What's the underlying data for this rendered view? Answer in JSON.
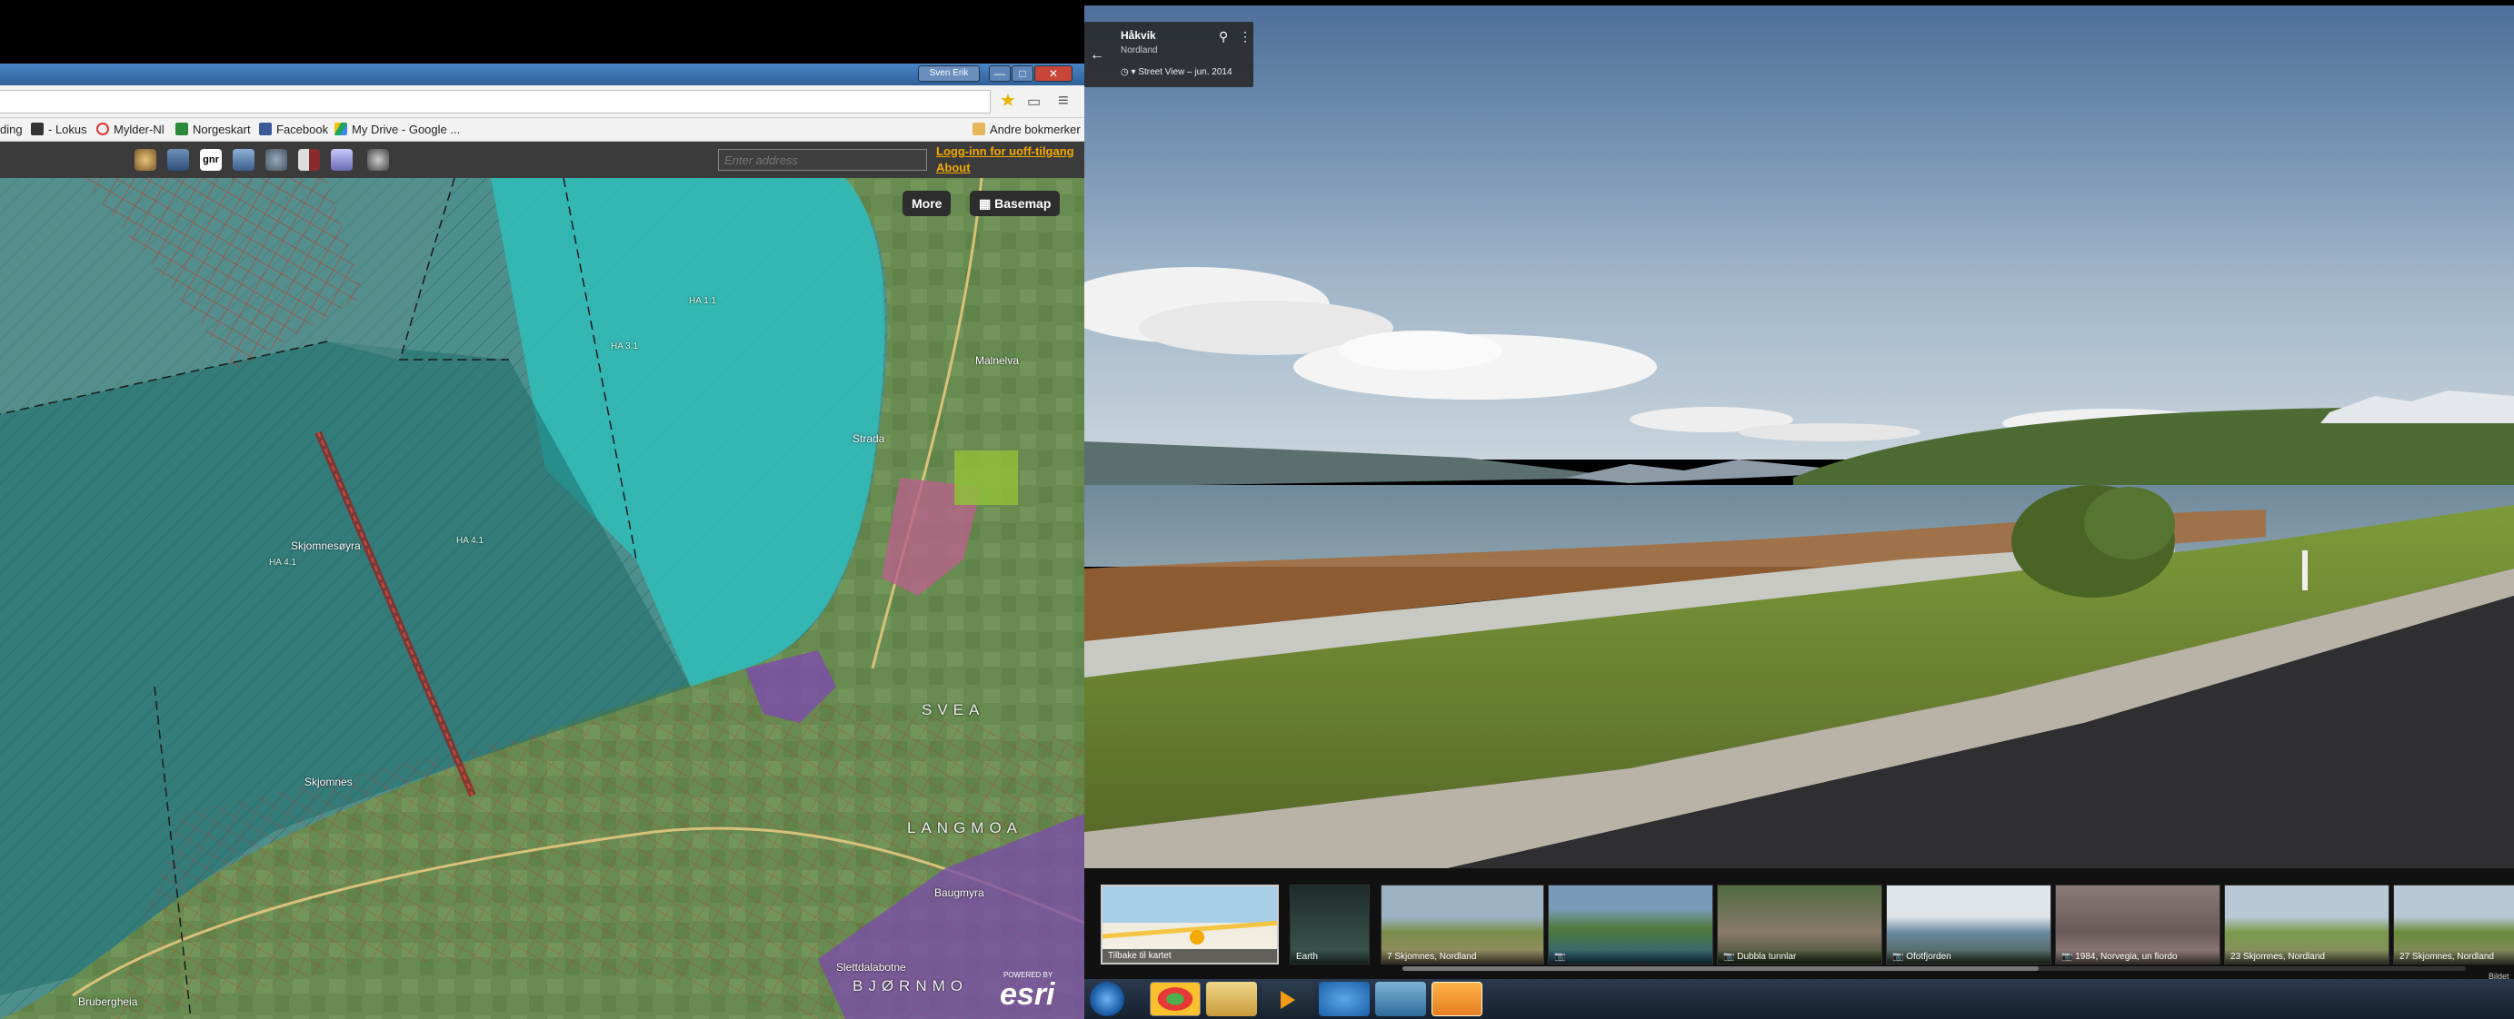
{
  "browser": {
    "window_controls": {
      "switch_user": "Sven Erik",
      "minimize": "—",
      "maximize": "□",
      "close": "✕"
    },
    "bookmarks": [
      {
        "label": "ding",
        "icon": "none"
      },
      {
        "label": "- Lokus",
        "icon": "lokus-icon"
      },
      {
        "label": "Mylder-Nl",
        "icon": "mylder-icon"
      },
      {
        "label": "Norgeskart",
        "icon": "norgeskart-icon"
      },
      {
        "label": "Facebook",
        "icon": "facebook-icon"
      },
      {
        "label": "My Drive - Google ...",
        "icon": "drive-icon"
      },
      {
        "label": "Andre bokmerker",
        "icon": "folder-icon"
      }
    ],
    "colors": {
      "titlebar": "#3a70b0",
      "toolbar": "#3b3b3b",
      "link": "#f2a900"
    }
  },
  "map_app": {
    "address_placeholder": "Enter address",
    "login_link": "Logg-inn for uoff-tilgang",
    "about_link": "About",
    "more_button": "More",
    "basemap_button": "Basemap",
    "tool_icons": [
      "compass-icon",
      "truck-icon",
      "gnr-icon",
      "layers-icon",
      "gears-icon",
      "book-icon",
      "cube-icon",
      "vehicle-icon"
    ],
    "gnr_label": "gnr",
    "labels": {
      "skjomnesoyra": "Skjomnesøyra",
      "skjomnes": "Skjomnes",
      "strada": "Strada",
      "malnelva": "Malnelva",
      "svea": "SVEA",
      "langmoa": "LANGMOA",
      "bjornmo": "BJØRNMO",
      "slettdalabotne": "Slettdalabotne",
      "baugmyra": "Baugmyra",
      "bruberget": "Brubergheia",
      "ha41a": "HA 4.1",
      "ha41b": "HA 4.1",
      "ha31": "HA 3.1",
      "ha11": "HA 1.1"
    },
    "esri_logo": "esri",
    "esri_powered": "POWERED BY"
  },
  "street_view": {
    "location_title": "Håkvik",
    "region": "Nordland",
    "date": "Street View – jun. 2014",
    "back_icon": "arrow-left-icon",
    "filmstrip": [
      {
        "caption": "Tilbake til kartet",
        "kind": "map"
      },
      {
        "caption": "Earth",
        "kind": "earth"
      },
      {
        "caption": "7 Skjomnes, Nordland",
        "kind": "photo"
      },
      {
        "caption": "",
        "kind": "photo"
      },
      {
        "caption": "Dubbla tunnlar",
        "kind": "photo"
      },
      {
        "caption": "Ofotfjorden",
        "kind": "photo"
      },
      {
        "caption": "1984, Norvegia, un fiordo",
        "kind": "photo"
      },
      {
        "caption": "23 Skjomnes, Nordland",
        "kind": "photo"
      },
      {
        "caption": "27 Skjomnes, Nordland",
        "kind": "photo"
      }
    ],
    "strip_tail": "Bildet"
  },
  "taskbar": {
    "apps": [
      "start-orb",
      "chrome-icon",
      "explorer-icon",
      "media-player-icon",
      "ie-icon",
      "app-icon",
      "outlook-icon"
    ]
  }
}
